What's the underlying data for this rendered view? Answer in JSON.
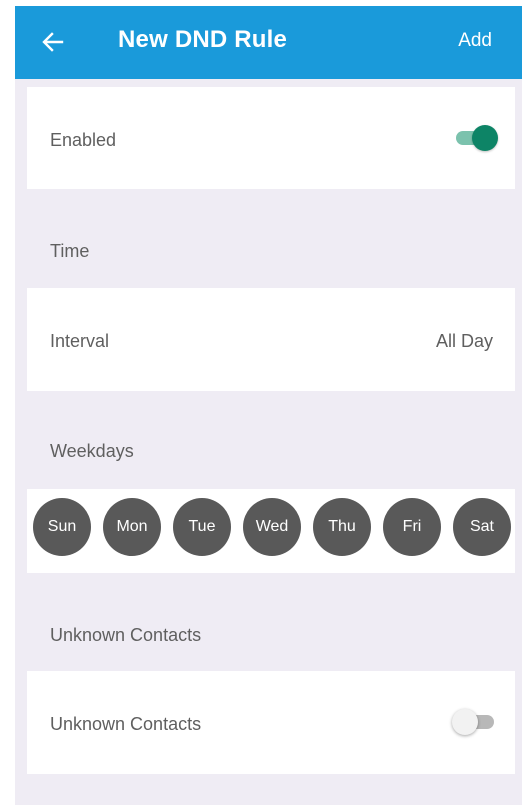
{
  "header": {
    "title": "New DND Rule",
    "back_icon": "arrow-left-icon",
    "add_label": "Add",
    "background_color": "#1a9ada"
  },
  "enabled": {
    "label": "Enabled",
    "toggle_on": true,
    "accent_color": "#0d8466"
  },
  "time": {
    "section_title": "Time",
    "interval_label": "Interval",
    "interval_value": "All Day"
  },
  "weekdays": {
    "section_title": "Weekdays",
    "days": [
      "Sun",
      "Mon",
      "Tue",
      "Wed",
      "Thu",
      "Fri",
      "Sat"
    ],
    "day_color": "#595959"
  },
  "unknown_contacts": {
    "section_title": "Unknown Contacts",
    "label": "Unknown Contacts",
    "toggle_on": false
  }
}
